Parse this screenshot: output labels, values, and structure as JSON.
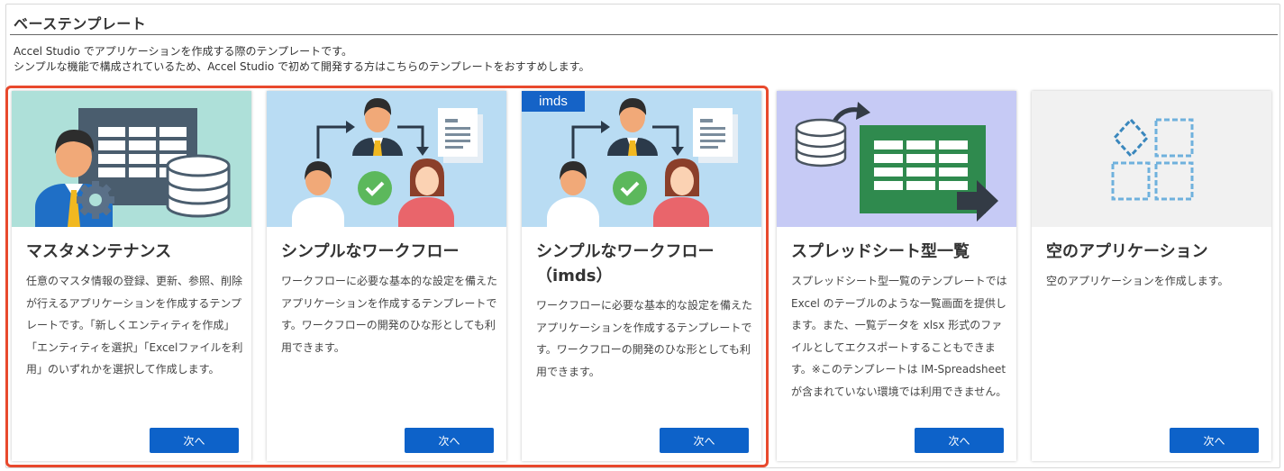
{
  "section": {
    "title": "ベーステンプレート",
    "description_line1": "Accel Studio でアプリケーションを作成する際のテンプレートです。",
    "description_line2": "シンプルな機能で構成されているため、Accel Studio で初めて開発する方はこちらのテンプレートをおすすめします。"
  },
  "colors": {
    "highlight": "#e8492d",
    "button": "#0d62c9",
    "badge": "#1563c7"
  },
  "cards": [
    {
      "title": "マスタメンテナンス",
      "description": "任意のマスタ情報の登録、更新、参照、削除が行えるアプリケーションを作成するテンプレートです。「新しくエンティティを作成」「エンティティを選択」「Excelファイルを利用」のいずれかを選択して作成します。",
      "button": "次へ",
      "icon": "master-data-table-icon"
    },
    {
      "title": "シンプルなワークフロー",
      "description": "ワークフローに必要な基本的な設定を備えたアプリケーションを作成するテンプレートです。ワークフローの開発のひな形としても利用できます。",
      "button": "次へ",
      "icon": "workflow-approval-icon"
    },
    {
      "badge": "imds",
      "title": "シンプルなワークフロー（imds）",
      "description": "ワークフローに必要な基本的な設定を備えたアプリケーションを作成するテンプレートです。ワークフローの開発のひな形としても利用できます。",
      "button": "次へ",
      "icon": "workflow-approval-icon"
    },
    {
      "title": "スプレッドシート型一覧",
      "description": "スプレッドシート型一覧のテンプレートでは Excel のテーブルのような一覧画面を提供します。また、一覧データを xlsx 形式のファイルとしてエクスポートすることもできます。※このテンプレートは IM-Spreadsheet が含まれていない環境では利用できません。",
      "button": "次へ",
      "icon": "spreadsheet-export-icon"
    },
    {
      "title": "空のアプリケーション",
      "description": "空のアプリケーションを作成します。",
      "button": "次へ",
      "icon": "empty-application-icon"
    }
  ]
}
